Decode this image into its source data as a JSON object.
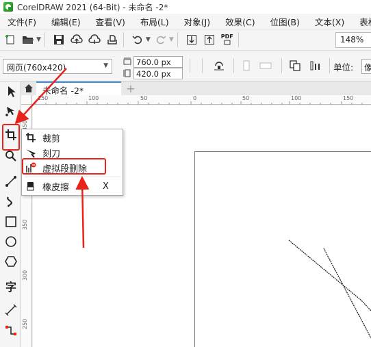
{
  "window": {
    "title": "CorelDRAW 2021 (64-Bit) - 未命名 -2*"
  },
  "menu": [
    "文件(F)",
    "编辑(E)",
    "查看(V)",
    "布局(L)",
    "对象(J)",
    "效果(C)",
    "位图(B)",
    "文本(X)",
    "表格"
  ],
  "toolbar": {
    "zoom": "148%",
    "pdf_label": "PDF"
  },
  "property_bar": {
    "page_preset": "网页(760x420)",
    "width": "760.0 px",
    "height": "420.0 px",
    "unit_label": "单位:",
    "unit_value": "像"
  },
  "document_tab": {
    "name": "未命名 -2*",
    "add": "+"
  },
  "ruler": {
    "h_labels": [
      "150",
      "100",
      "50",
      "0",
      "50",
      "100",
      "150"
    ],
    "v_labels": [
      "450",
      "400",
      "350",
      "300",
      "250"
    ]
  },
  "toolbox": {
    "text_tool_glyph": "字"
  },
  "flyout": {
    "items": [
      {
        "label": "裁剪",
        "icon": "crop-icon",
        "shortcut": ""
      },
      {
        "label": "刻刀",
        "icon": "knife-icon",
        "shortcut": ""
      },
      {
        "label": "虚拟段删除",
        "icon": "virtual-segment-delete-icon",
        "shortcut": ""
      },
      {
        "label": "橡皮擦",
        "icon": "eraser-icon",
        "shortcut": "X"
      }
    ]
  },
  "annotation_color": "#e8231b"
}
